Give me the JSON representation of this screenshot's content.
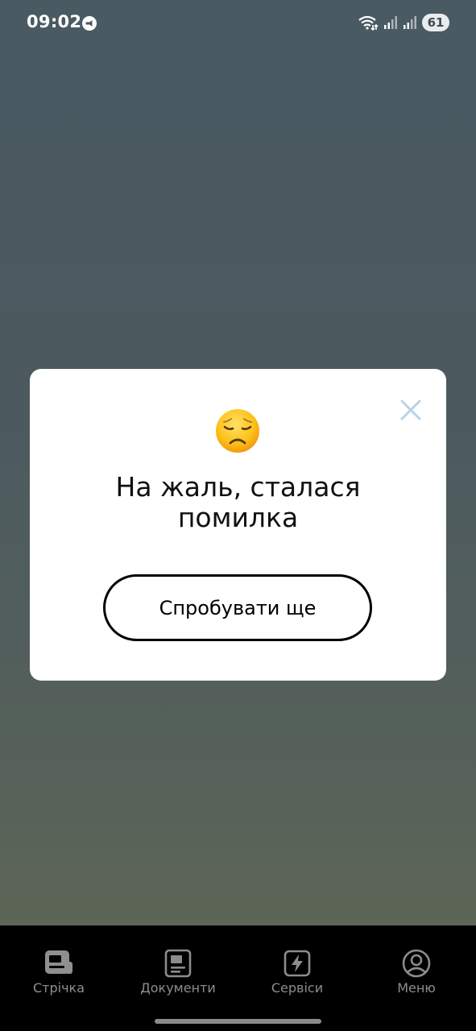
{
  "status_bar": {
    "time": "09:02",
    "battery": "61",
    "icons": [
      "notification-icon",
      "wifi-icon",
      "signal-icon",
      "signal-icon-2",
      "battery-icon"
    ]
  },
  "dialog": {
    "emoji": "disappointed-face",
    "title": "На жаль, сталася помилка",
    "retry_label": "Спробувати ще",
    "close_icon": "close-icon",
    "accent_close": "#b9d3e6"
  },
  "nav": {
    "items": [
      {
        "label": "Стрічка",
        "icon": "feed-icon"
      },
      {
        "label": "Документи",
        "icon": "documents-icon"
      },
      {
        "label": "Сервіси",
        "icon": "services-icon"
      },
      {
        "label": "Меню",
        "icon": "profile-icon"
      }
    ]
  },
  "colors": {
    "background_top": "#4a5a62",
    "background_bottom": "#5d6656",
    "nav_background": "#000000",
    "nav_text": "#8c8c8c"
  }
}
